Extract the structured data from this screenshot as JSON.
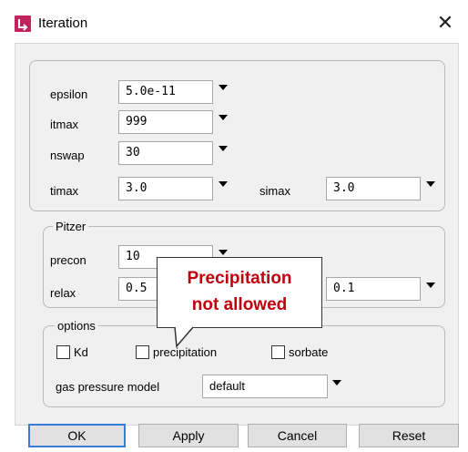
{
  "window": {
    "title": "Iteration",
    "close_glyph": "✕"
  },
  "fields": {
    "epsilon": {
      "label": "epsilon",
      "value": "5.0e-11"
    },
    "itmax": {
      "label": "itmax",
      "value": "999"
    },
    "nswap": {
      "label": "nswap",
      "value": "30"
    },
    "timax": {
      "label": "timax",
      "value": "3.0"
    },
    "simax": {
      "label": "simax",
      "value": "3.0"
    }
  },
  "pitzer": {
    "title": "Pitzer",
    "precon": {
      "label": "precon",
      "value": "10"
    },
    "relax": {
      "label": "relax",
      "value": "0.5",
      "value2": "0.1"
    }
  },
  "options": {
    "title": "options",
    "checkboxes": [
      {
        "label": "Kd",
        "checked": false
      },
      {
        "label": "precipitation",
        "checked": false
      },
      {
        "label": "sorbate",
        "checked": false
      }
    ],
    "gas_pressure_model": {
      "label": "gas pressure model",
      "value": "default"
    }
  },
  "callout": {
    "line1": "Precipitation",
    "line2": "not allowed"
  },
  "buttons": {
    "ok": "OK",
    "apply": "Apply",
    "cancel": "Cancel",
    "reset": "Reset"
  },
  "colors": {
    "icon": "#c0245c",
    "callout_text": "#c0000b",
    "default_button_border": "#3a7bd5"
  }
}
